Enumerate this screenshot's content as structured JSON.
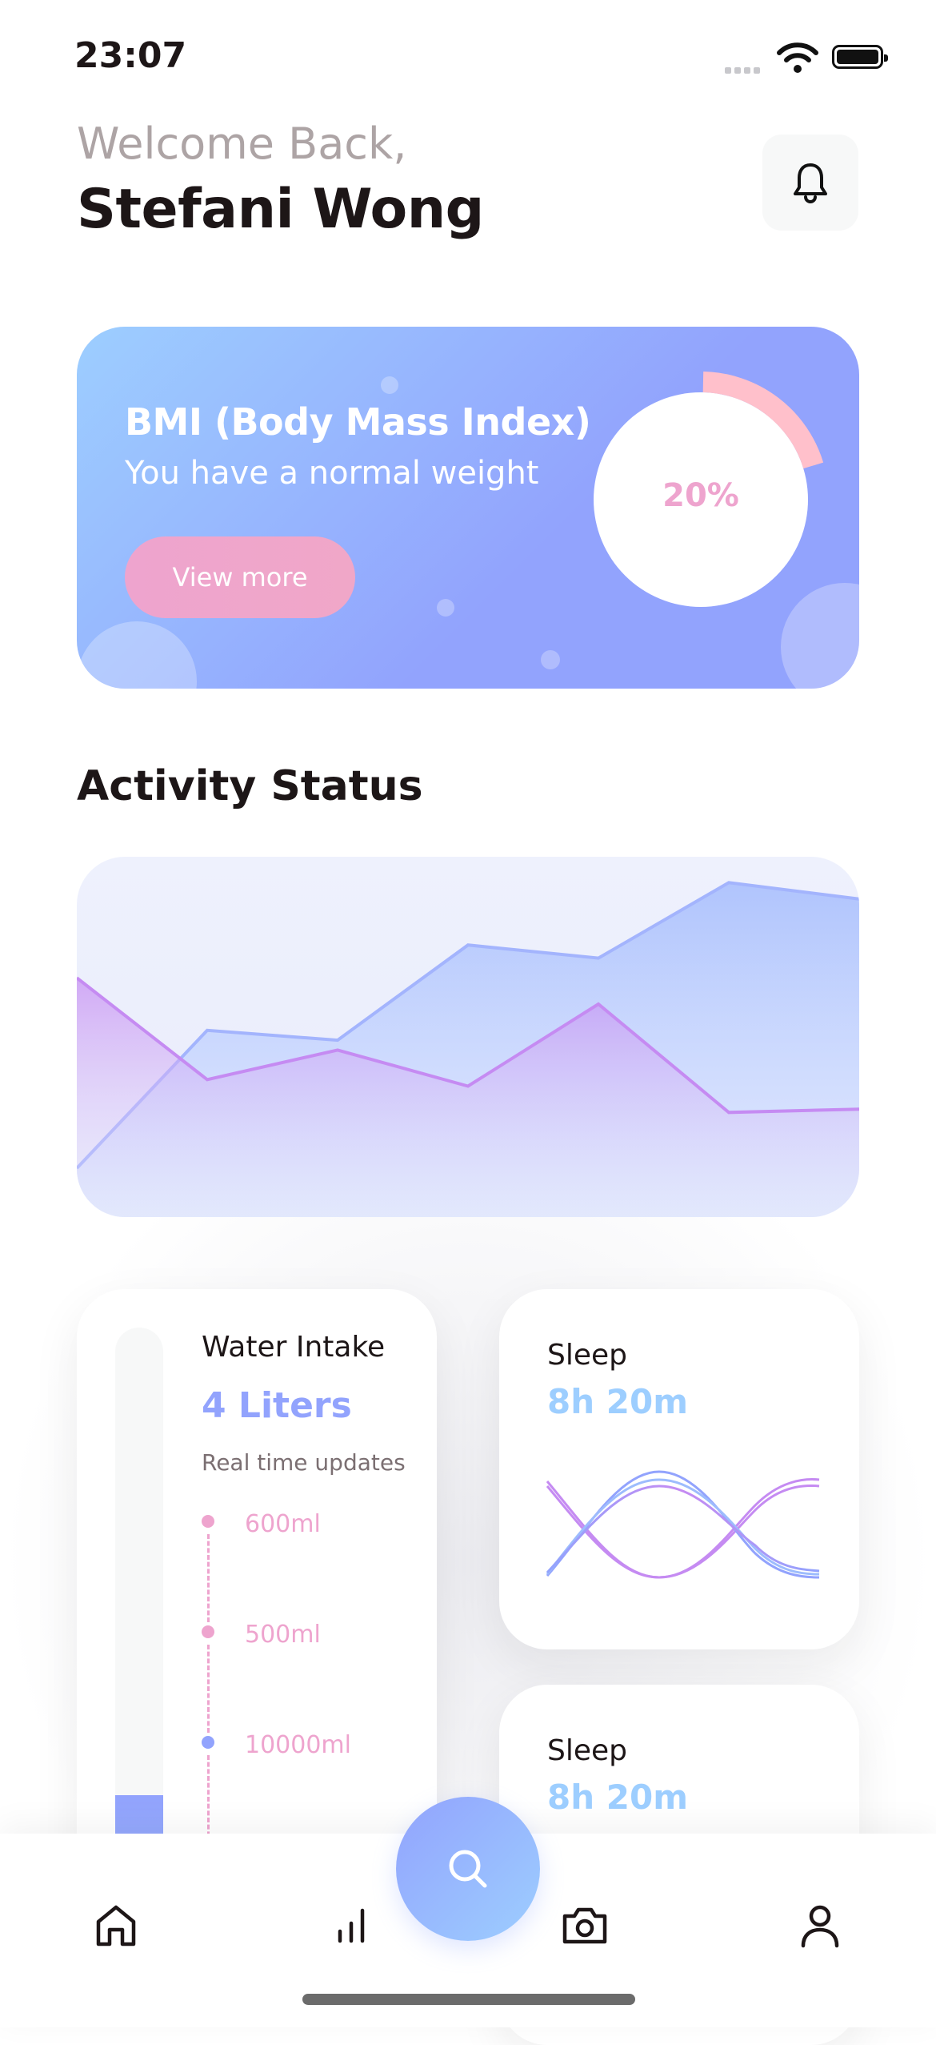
{
  "status_bar": {
    "time": "23:07"
  },
  "header": {
    "welcome": "Welcome Back,",
    "user_name": "Stefani Wong"
  },
  "bmi_card": {
    "title": "BMI (Body Mass Index)",
    "subtitle": "You have a normal weight",
    "button_label": "View more",
    "percent_label": "20%",
    "ring_fraction": 0.2
  },
  "activity": {
    "section_title": "Activity Status",
    "chart_data": {
      "type": "area",
      "series": [
        {
          "values": [
            10,
            52,
            49,
            78,
            74,
            97,
            92
          ]
        },
        {
          "values": [
            68,
            37,
            46,
            35,
            60,
            27,
            28
          ]
        }
      ],
      "ylim": [
        0,
        100
      ]
    }
  },
  "water_card": {
    "title": "Water Intake",
    "amount": "4 Liters",
    "subtitle": "Real time updates",
    "fill_fraction": 0.27,
    "timeline": [
      {
        "label": "600ml",
        "color": "#eea4ce"
      },
      {
        "label": "500ml",
        "color": "#eea4ce"
      },
      {
        "label": "10000ml",
        "color": "#92a3fd"
      }
    ]
  },
  "sleep_cards": [
    {
      "title": "Sleep",
      "value": "8h 20m"
    },
    {
      "title": "Sleep",
      "value": "8h 20m"
    }
  ],
  "nav": {
    "items": [
      "home-icon",
      "activity-icon",
      "search-icon",
      "camera-icon",
      "profile-icon"
    ]
  },
  "colors": {
    "brand_blue": "#92a3fd",
    "light_blue": "#9dceff",
    "pink": "#eea4ce",
    "text_dark": "#1d1617",
    "text_gray": "#ada4a5"
  }
}
